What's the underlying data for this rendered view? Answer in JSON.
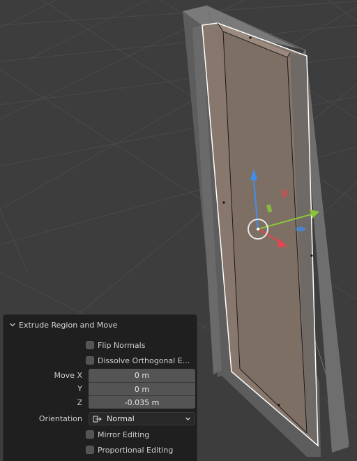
{
  "panel": {
    "title": "Extrude Region and Move",
    "flip_normals": {
      "label": "Flip Normals",
      "checked": false
    },
    "dissolve_orthogonal": {
      "label": "Dissolve Orthogonal E...",
      "checked": false
    },
    "move": {
      "x_label": "Move X",
      "x_value": "0 m",
      "y_label": "Y",
      "y_value": "0 m",
      "z_label": "Z",
      "z_value": "-0.035 m"
    },
    "orientation": {
      "label": "Orientation",
      "value": "Normal"
    },
    "mirror_editing": {
      "label": "Mirror Editing",
      "checked": false
    },
    "proportional_editing": {
      "label": "Proportional Editing",
      "checked": false
    }
  },
  "colors": {
    "viewport_bg": "#3d3d3d",
    "face_fill": "#8a7a6e",
    "axis_x": "#e8434f",
    "axis_y": "#8ac43a",
    "axis_z": "#3f8ff0"
  },
  "icons": [
    "chevron-down-icon",
    "orientation-normal-icon",
    "dropdown-chevron-icon"
  ]
}
